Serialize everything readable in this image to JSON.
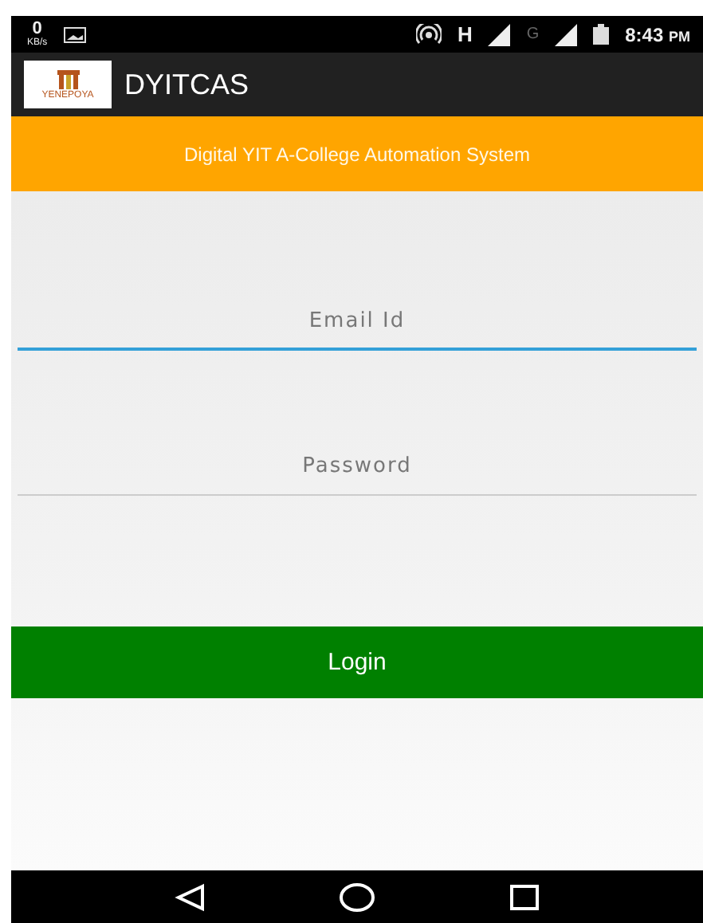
{
  "status_bar": {
    "speed_value": "0",
    "speed_unit": "KB/s",
    "time": "8:43",
    "meridiem": "PM",
    "network_type": "H",
    "second_network_type": "G"
  },
  "app_bar": {
    "logo_text": "YENEPOYA",
    "title": "DYITCAS"
  },
  "banner": {
    "text": "Digital YIT A-College Automation System"
  },
  "fields": [
    {
      "placeholder": "Email Id",
      "focused": true
    },
    {
      "placeholder": "Password",
      "focused": false
    }
  ],
  "login_button": {
    "label": "Login"
  }
}
